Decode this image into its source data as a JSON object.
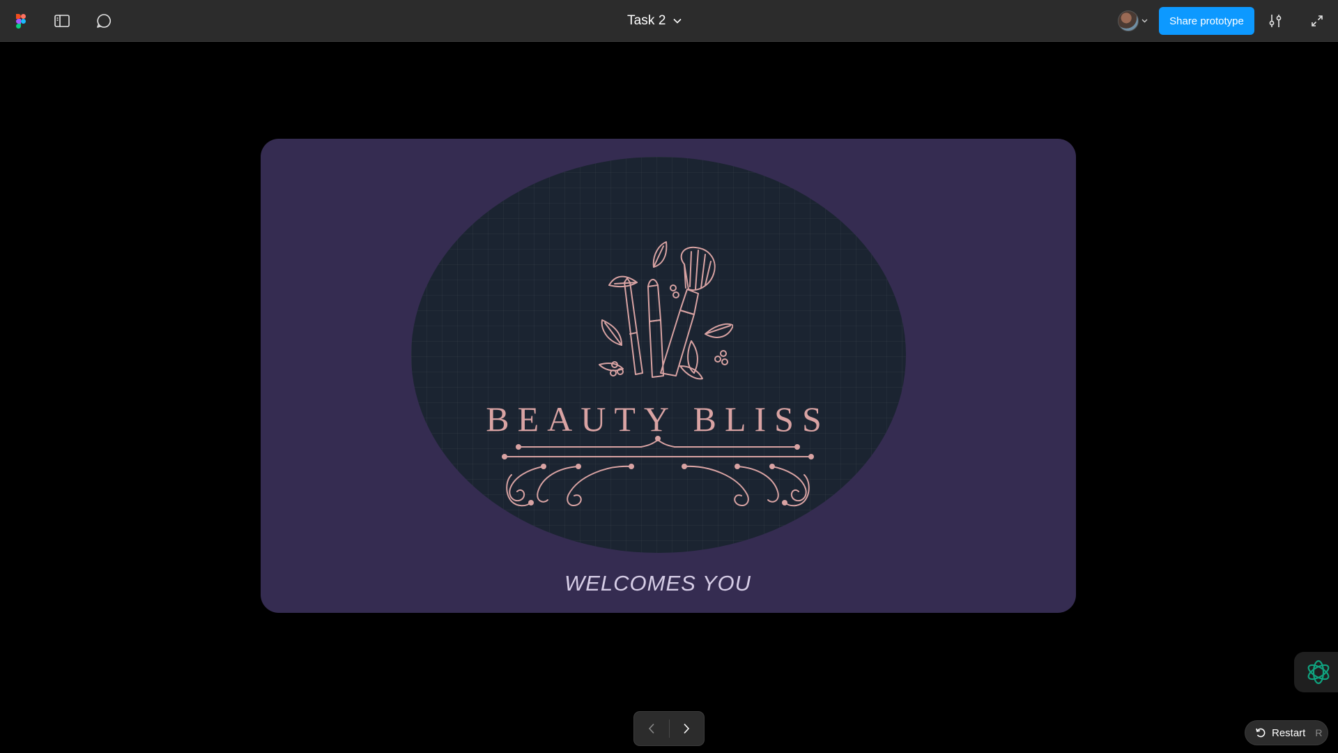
{
  "toolbar": {
    "file_title": "Task 2",
    "share_label": "Share prototype",
    "icons": {
      "logo": "figma-logo-icon",
      "panel": "sidebar-panel-icon",
      "comment": "comment-icon",
      "dropdown": "chevron-down-icon",
      "settings": "settings-sliders-icon",
      "fullscreen": "expand-icon"
    },
    "accent_color": "#0d99ff"
  },
  "frame": {
    "background": "#352c51",
    "oval_color": "#1b2431",
    "brand_name": "BEAUTY BLISS",
    "tagline": "WELCOMES YOU",
    "logo_color": "#d9a3a3"
  },
  "bottom": {
    "prev_icon": "chevron-left-icon",
    "next_icon": "chevron-right-icon",
    "restart_label": "Restart",
    "restart_shortcut": "R"
  }
}
